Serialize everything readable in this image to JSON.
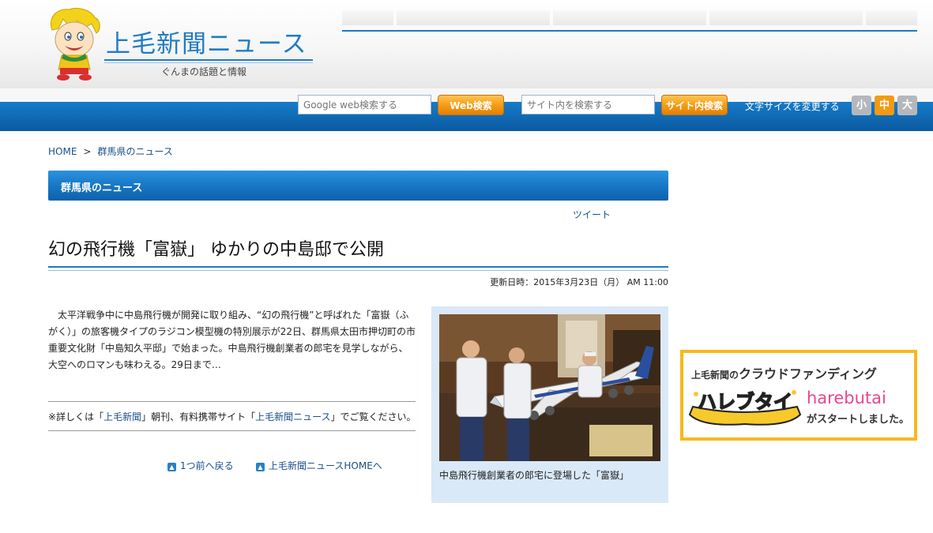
{
  "header": {
    "logo_title": "上毛新聞ニュース",
    "logo_tagline": "ぐんまの話題と情報"
  },
  "search": {
    "google_placeholder": "Google web検索する",
    "web_button": "Web検索",
    "site_placeholder": "サイト内を検索する",
    "site_button": "サイト内検索"
  },
  "font_size": {
    "label": "文字サイズを変更する",
    "small": "小",
    "medium": "中",
    "large": "大"
  },
  "breadcrumb": {
    "home": "HOME",
    "separator": ">",
    "current": "群馬県のニュース"
  },
  "section": {
    "title": "群馬県のニュース"
  },
  "tweet_label": "ツイート",
  "article": {
    "title": "幻の飛行機「富嶽」 ゆかりの中島邸で公開",
    "updated": "更新日時：2015年3月23日（月） AM 11:00",
    "body": "　太平洋戦争中に中島飛行機が開発に取り組み、“幻の飛行機”と呼ばれた「富嶽（ふがく）」の旅客機タイプのラジコン模型機の特別展示が22日、群馬県太田市押切町の市重要文化財「中島知久平邸」で始まった。中島飛行機創業者の郎宅を見学しながら、大空へのロマンも味わえる。29日まで…",
    "details_prefix": "※詳しくは「",
    "details_link1": "上毛新聞",
    "details_middle": "」朝刊、有料携帯サイト「",
    "details_link2": "上毛新聞ニュース",
    "details_suffix": "」でご覧ください。",
    "photo_caption": "中島飛行機創業者の郎宅に登場した「富嶽」"
  },
  "bottom_links": {
    "back": "1つ前へ戻る",
    "home": "上毛新聞ニュースHOMEへ"
  },
  "banner": {
    "top_prefix": "上毛新聞の",
    "top_main": "クラウドファンディング",
    "brand_jp": "ハレブタイ",
    "brand_en": "harebutai",
    "subtitle": "がスタートしました。"
  },
  "colors": {
    "brand_blue": "#1f7cc6",
    "orange_button": "#f39a12",
    "banner_pink": "#e8478f",
    "banner_gold": "#f7b91b"
  }
}
